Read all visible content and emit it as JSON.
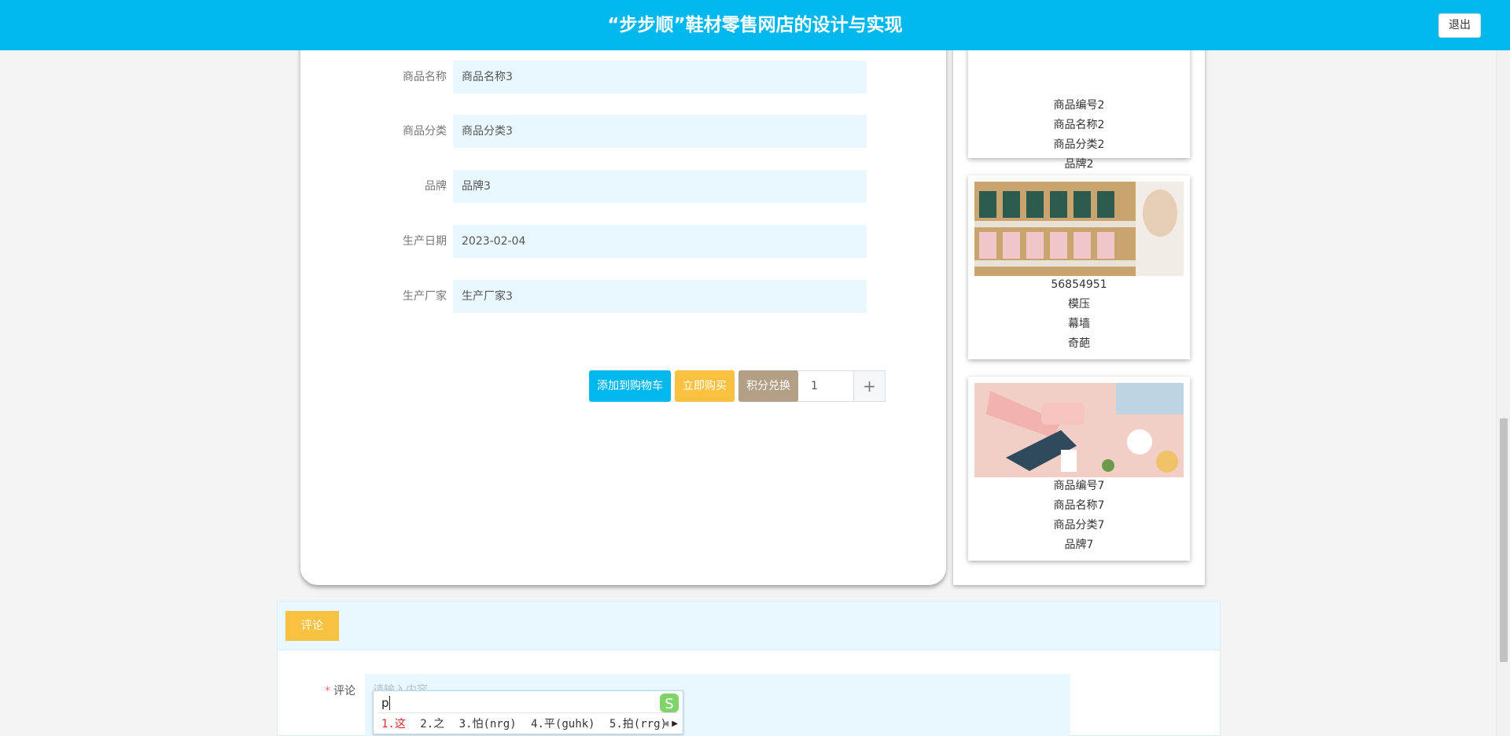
{
  "header": {
    "title": "“步步顺”鞋材零售网店的设计与实现",
    "logout_label": "退出"
  },
  "product_form": [
    {
      "label": "商品名称",
      "value": "商品名称3"
    },
    {
      "label": "商品分类",
      "value": "商品分类3"
    },
    {
      "label": "品牌",
      "value": "品牌3"
    },
    {
      "label": "生产日期",
      "value": "2023-02-04"
    },
    {
      "label": "生产厂家",
      "value": "生产厂家3"
    }
  ],
  "purchase": {
    "quantity": "1",
    "minus_symbol": "−",
    "plus_symbol": "+",
    "add_to_cart_label": "添加到购物车",
    "buy_now_label": "立即购买",
    "points_exchange_label": "积分兑换"
  },
  "recommendations": [
    {
      "lines": [
        "商品编号2",
        "商品名称2",
        "商品分类2",
        "品牌2"
      ],
      "image": "towels-photo"
    },
    {
      "lines": [
        "56854951",
        "模压",
        "幕墙",
        "奇葩"
      ],
      "image": "shoe-rack-photo"
    },
    {
      "lines": [
        "商品编号7",
        "商品名称7",
        "商品分类7",
        "品牌7"
      ],
      "image": "kitchen-grater-photo"
    }
  ],
  "comments": {
    "tab_label": "评论",
    "required_mark": "*",
    "field_label": "评论",
    "placeholder": "请输入内容"
  },
  "ime": {
    "typed": "p",
    "candidates": [
      "1.这",
      "2.之",
      "3.怕(nrg)",
      "4.平(guhk)",
      "5.拍(rrg)"
    ]
  },
  "colors": {
    "primary": "#00b7ee",
    "buy_now": "#f9c140",
    "points": "#b39e86",
    "comment_tab": "#f9c140",
    "input_bg": "#e8f8fe"
  }
}
